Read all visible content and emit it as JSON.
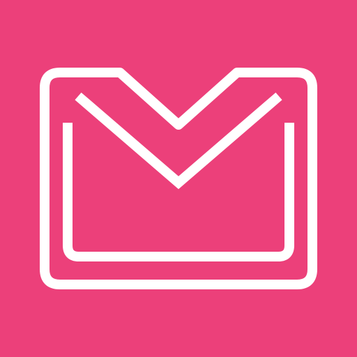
{
  "app_icon": {
    "icon": "mail-envelope-icon",
    "colors": {
      "background": "#EC407A",
      "stroke": "#FFFFFF"
    }
  }
}
